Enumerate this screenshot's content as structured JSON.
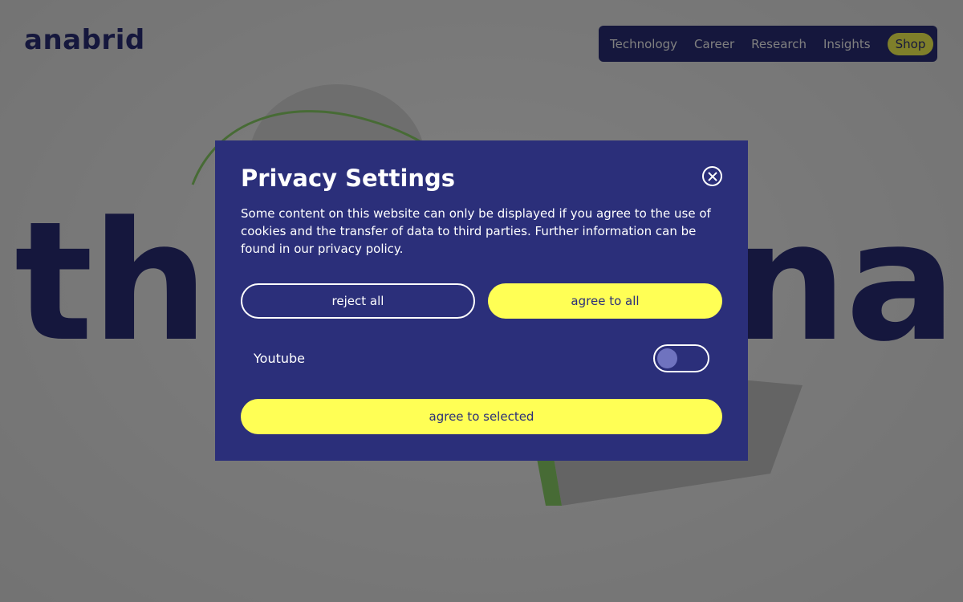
{
  "header": {
    "logo": "anabrid",
    "nav": [
      {
        "label": "Technology"
      },
      {
        "label": "Career"
      },
      {
        "label": "Research"
      },
      {
        "label": "Insights"
      }
    ],
    "shop_label": "Shop"
  },
  "hero": {
    "headline": "this is anabrid"
  },
  "modal": {
    "title": "Privacy Settings",
    "description": "Some content on this website can only be displayed if you agree to the use of cookies and the transfer of data to third parties. Further information can be found in our privacy policy.",
    "reject_label": "reject all",
    "agree_all_label": "agree to all",
    "toggle_label": "Youtube",
    "toggle_state": "off",
    "agree_selected_label": "agree to selected"
  },
  "colors": {
    "brand": "#2b2f7a",
    "accent": "#ffff55"
  }
}
